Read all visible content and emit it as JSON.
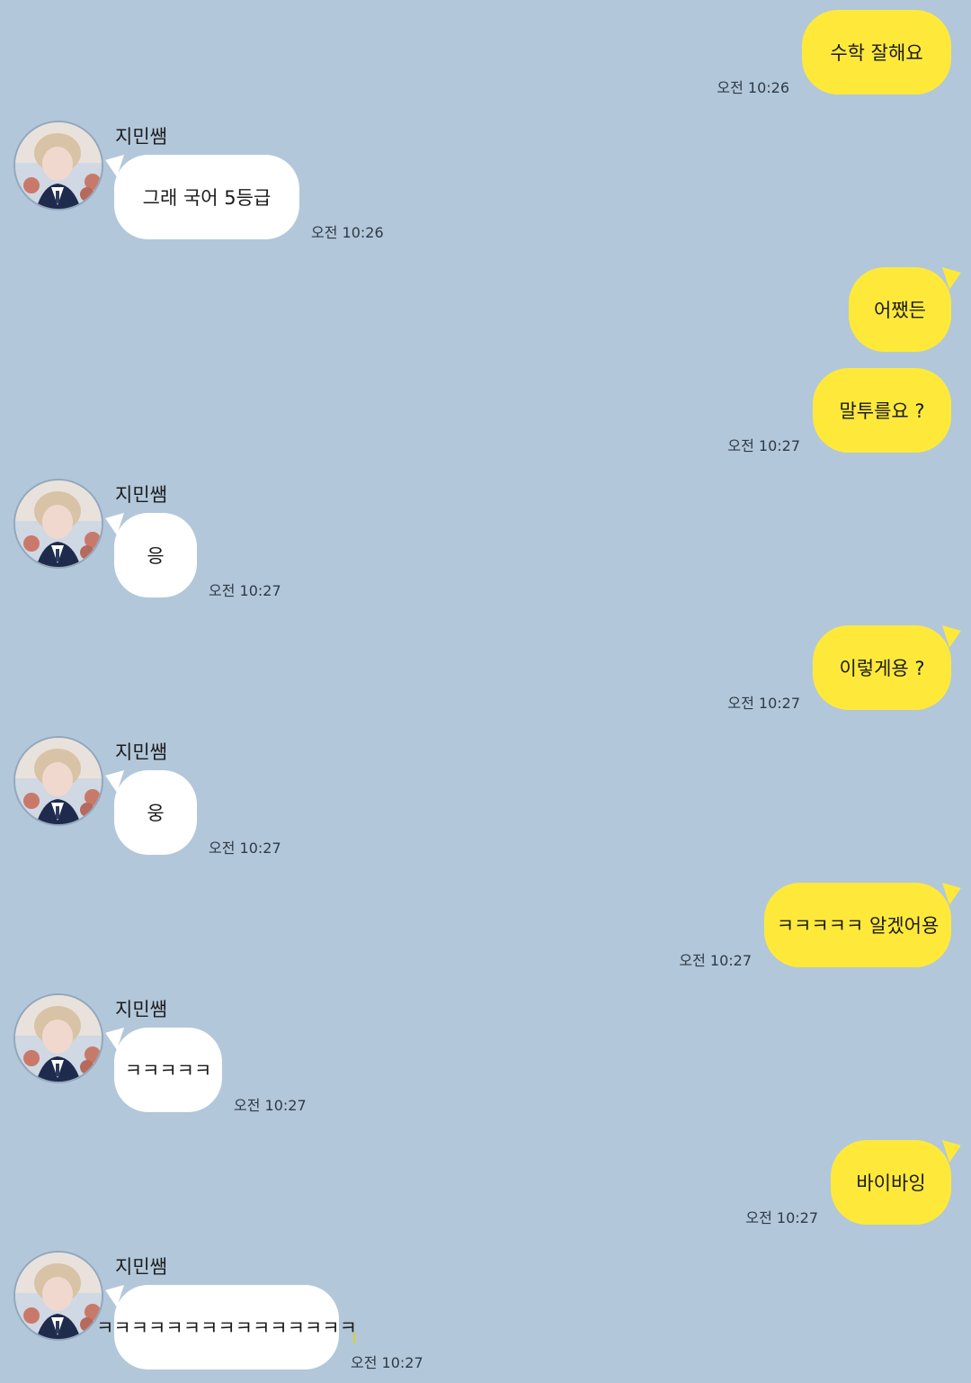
{
  "conversation": {
    "contact_name": "지민쌤",
    "colors": {
      "background": "#b2c7da",
      "outgoing_bubble": "#fee93b",
      "incoming_bubble": "#ffffff"
    },
    "messages": [
      {
        "dir": "out",
        "text": "수학 잘해요",
        "time": "오전 10:26"
      },
      {
        "dir": "in",
        "sender": "지민쌤",
        "text": "그래 국어 5등급",
        "time": "오전 10:26"
      },
      {
        "dir": "out",
        "text": "어쨌든",
        "time": ""
      },
      {
        "dir": "out",
        "text": "말투를요 ?",
        "time": "오전 10:27"
      },
      {
        "dir": "in",
        "sender": "지민쌤",
        "text": "응",
        "time": "오전 10:27"
      },
      {
        "dir": "out",
        "text": "이렇게용 ?",
        "time": "오전 10:27"
      },
      {
        "dir": "in",
        "sender": "지민쌤",
        "text": "웅",
        "time": "오전 10:27"
      },
      {
        "dir": "out",
        "text": "ㅋㅋㅋㅋㅋ 알겠어용",
        "time": "오전 10:27"
      },
      {
        "dir": "in",
        "sender": "지민쌤",
        "text": "ㅋㅋㅋㅋㅋ",
        "time": "오전 10:27"
      },
      {
        "dir": "out",
        "text": "바이바잉",
        "time": "오전 10:27"
      },
      {
        "dir": "in",
        "sender": "지민쌤",
        "text": "ㅋㅋㅋㅋㅋㅋㅋㅋㅋㅋㅋㅋㅋㅋㅋ",
        "time": "오전 10:27"
      }
    ]
  }
}
